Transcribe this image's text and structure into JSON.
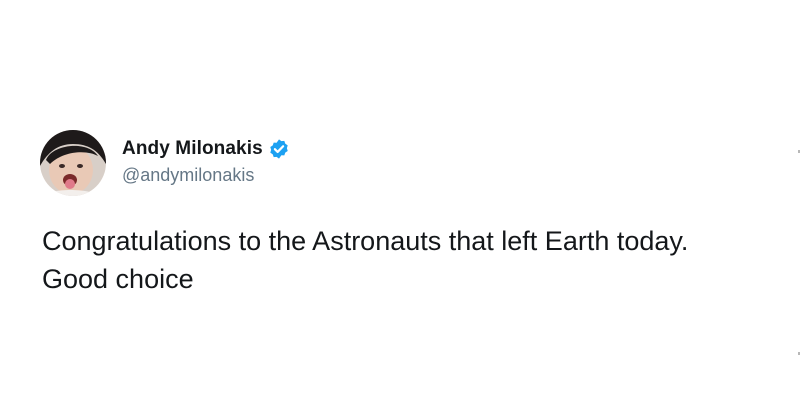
{
  "tweet": {
    "author": {
      "display_name": "Andy Milonakis",
      "handle": "@andymilonakis",
      "verified": true,
      "avatar_icon": "profile-photo"
    },
    "text_lines": [
      "Congratulations to the Astronauts that left Earth today.",
      "Good choice"
    ]
  },
  "colors": {
    "background": "#ffffff",
    "name": "#14171a",
    "handle": "#657786",
    "verified": "#1da1f2"
  }
}
